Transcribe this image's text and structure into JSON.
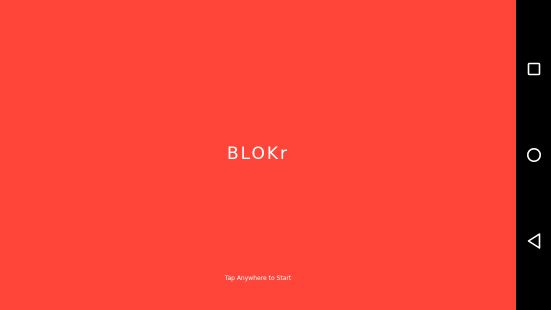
{
  "game": {
    "title": "BLOKr",
    "start_hint": "Tap Anywhere to Start",
    "background_color": "#FF453A"
  },
  "nav_bar": {
    "buttons": [
      {
        "name": "recents",
        "icon": "square-icon"
      },
      {
        "name": "home",
        "icon": "circle-icon"
      },
      {
        "name": "back",
        "icon": "triangle-back-icon"
      }
    ],
    "background_color": "#000000",
    "icon_color": "#FFFFFF"
  }
}
